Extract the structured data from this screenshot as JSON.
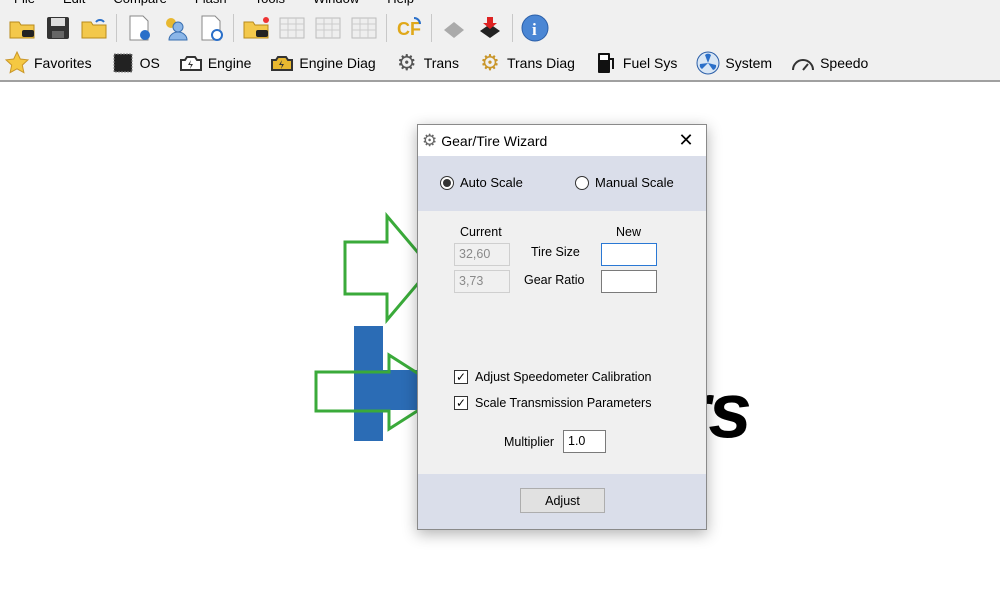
{
  "menu": [
    "File",
    "Edit",
    "Compare",
    "Flash",
    "Tools",
    "Window",
    "Help"
  ],
  "toolbar_icons": [
    "open-folder-icon",
    "save-icon",
    "open-recent-icon",
    "file-info-icon",
    "license-user-icon",
    "file-history-icon",
    "open-folder-new-icon",
    "table-icon",
    "table-icon",
    "table-icon",
    "cf-convert-icon",
    "chip-read-icon",
    "chip-write-icon",
    "info-icon"
  ],
  "nav": [
    {
      "label": "Favorites",
      "icon": "star-icon"
    },
    {
      "label": "OS",
      "icon": "chip-icon"
    },
    {
      "label": "Engine",
      "icon": "engine-icon"
    },
    {
      "label": "Engine Diag",
      "icon": "engine-diag-icon"
    },
    {
      "label": "Trans",
      "icon": "gear-icon"
    },
    {
      "label": "Trans Diag",
      "icon": "gear-diag-icon"
    },
    {
      "label": "Fuel Sys",
      "icon": "fuel-pump-icon"
    },
    {
      "label": "System",
      "icon": "fan-icon"
    },
    {
      "label": "Speedo",
      "icon": "speedometer-icon"
    }
  ],
  "background_logo": "rs",
  "dialog": {
    "title": "Gear/Tire Wizard",
    "auto_scale": "Auto Scale",
    "manual_scale": "Manual Scale",
    "mode": "Auto Scale",
    "current_header": "Current",
    "new_header": "New",
    "tire_size_label": "Tire Size",
    "gear_ratio_label": "Gear Ratio",
    "current_tire_size": "32,60",
    "current_gear_ratio": "3,73",
    "new_tire_size": "",
    "new_gear_ratio": "",
    "adjust_speedo": "Adjust Speedometer Calibration",
    "adjust_speedo_checked": true,
    "scale_trans": "Scale Transmission Parameters",
    "scale_trans_checked": true,
    "multiplier_label": "Multiplier",
    "multiplier": "1.0",
    "adjust_button": "Adjust"
  },
  "colors": {
    "annotation_arrow": "#3aaa3a",
    "logo_blue": "#2b6cb5",
    "dialog_band": "#dadeea"
  }
}
